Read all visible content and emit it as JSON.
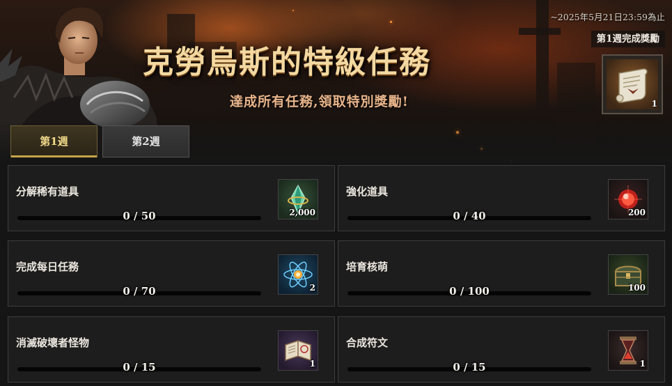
{
  "header": {
    "title": "克勞烏斯的特級任務",
    "subtitle": "達成所有任務,領取特別獎勵!",
    "deadline": "~2025年5月21日23:59為止",
    "week_reward_label": "第1週完成獎勵",
    "week_reward": {
      "icon": "scroll-icon",
      "quantity": "1"
    }
  },
  "tabs": [
    {
      "label": "第1週",
      "active": true
    },
    {
      "label": "第2週",
      "active": false
    }
  ],
  "quests": [
    {
      "name": "分解稀有道具",
      "progress": "0  /  50",
      "current": 0,
      "target": 50,
      "reward_icon": "green-crystal-icon",
      "reward_qty": "2,000"
    },
    {
      "name": "強化道具",
      "progress": "0  /  40",
      "current": 0,
      "target": 40,
      "reward_icon": "red-orb-icon",
      "reward_qty": "200"
    },
    {
      "name": "完成每日任務",
      "progress": "0  /  70",
      "current": 0,
      "target": 70,
      "reward_icon": "atom-orb-icon",
      "reward_qty": "2"
    },
    {
      "name": "培育核萌",
      "progress": "0  /  100",
      "current": 0,
      "target": 100,
      "reward_icon": "treasure-chest-icon",
      "reward_qty": "100"
    },
    {
      "name": "消滅破壞者怪物",
      "progress": "0  /  15",
      "current": 0,
      "target": 15,
      "reward_icon": "spellbook-icon",
      "reward_qty": "1"
    },
    {
      "name": "合成符文",
      "progress": "0  /  15",
      "current": 0,
      "target": 15,
      "reward_icon": "hourglass-icon",
      "reward_qty": "1"
    }
  ],
  "colors": {
    "title_gold": "#f3d9a1",
    "subtitle_orange": "#e8b48a",
    "tab_active_text": "#f1d98a",
    "tab_active_underline": "#c8a44a"
  }
}
